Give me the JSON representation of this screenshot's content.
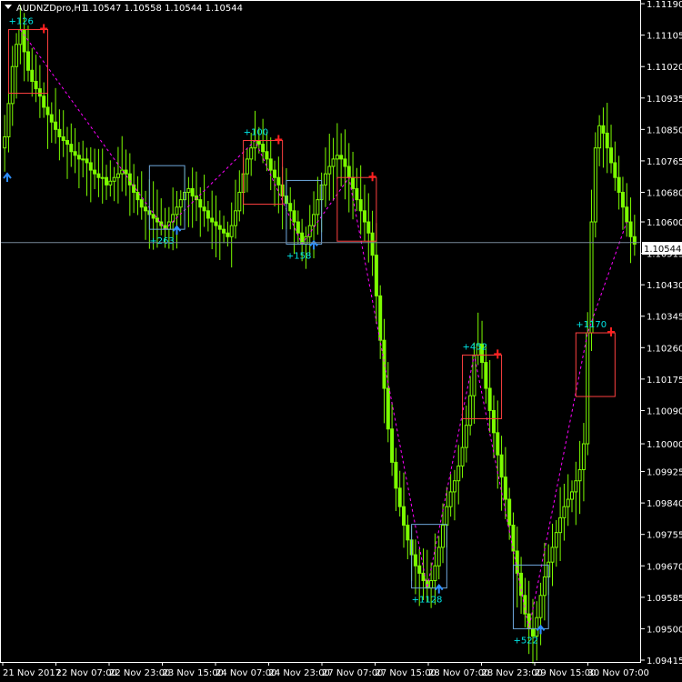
{
  "header": {
    "symbol": "AUDNZDpro,H1",
    "ohlc": "1.10547 1.10558 1.10544 1.10544"
  },
  "colors": {
    "background": "#000000",
    "axis": "#ffffff",
    "candles": "#7cfc00",
    "bid_line": "#778899",
    "zigzag": "#ff00ff",
    "top_box": "#ff4040",
    "bottom_box": "#6fa8dc",
    "top_label": "#00e5e5",
    "bottom_label": "#00e5e5",
    "up_arrow": "#2f8fff",
    "down_arrow": "#ff2020"
  },
  "chart_data": {
    "type": "candlestick",
    "title": "AUDNZDpro,H1",
    "ylim": [
      1.0941,
      1.112
    ],
    "price_ticks": [
      "1.11190",
      "1.11105",
      "1.11020",
      "1.10935",
      "1.10850",
      "1.10765",
      "1.10680",
      "1.10600",
      "1.10515",
      "1.10430",
      "1.10345",
      "1.10260",
      "1.10175",
      "1.10090",
      "1.10000",
      "1.09925",
      "1.09840",
      "1.09755",
      "1.09670",
      "1.09585",
      "1.09500",
      "1.09415"
    ],
    "time_ticks": [
      "21 Nov 2017",
      "22 Nov 07:00",
      "22 Nov 23:00",
      "23 Nov 15:00",
      "24 Nov 07:00",
      "24 Nov 23:00",
      "27 Nov 07:00",
      "27 Nov 15:00",
      "28 Nov 07:00",
      "28 Nov 23:00",
      "29 Nov 15:00",
      "30 Nov 07:00"
    ],
    "current_price": "1.10544",
    "closes": [
      1.1083,
      1.1092,
      1.1102,
      1.1108,
      1.1112,
      1.1106,
      1.1101,
      1.1098,
      1.1096,
      1.1094,
      1.1091,
      1.1089,
      1.1087,
      1.1085,
      1.1083,
      1.1082,
      1.1081,
      1.1079,
      1.1078,
      1.1077,
      1.1077,
      1.1076,
      1.1074,
      1.1073,
      1.1072,
      1.1072,
      1.107,
      1.1071,
      1.1072,
      1.1073,
      1.1074,
      1.1073,
      1.107,
      1.1068,
      1.1066,
      1.1064,
      1.1063,
      1.1062,
      1.1061,
      1.106,
      1.1059,
      1.1058,
      1.106,
      1.1062,
      1.1064,
      1.1066,
      1.1068,
      1.1069,
      1.1067,
      1.1066,
      1.1064,
      1.1063,
      1.1061,
      1.106,
      1.1059,
      1.1058,
      1.1057,
      1.1056,
      1.1059,
      1.1063,
      1.1068,
      1.1073,
      1.1077,
      1.108,
      1.1082,
      1.1081,
      1.1079,
      1.1077,
      1.1074,
      1.1072,
      1.107,
      1.1067,
      1.1065,
      1.1063,
      1.106,
      1.1057,
      1.1054,
      1.1056,
      1.1059,
      1.1062,
      1.1066,
      1.107,
      1.1073,
      1.1075,
      1.1077,
      1.1078,
      1.1077,
      1.1075,
      1.1072,
      1.1069,
      1.1066,
      1.1063,
      1.106,
      1.1057,
      1.1051,
      1.104,
      1.1028,
      1.1015,
      1.1004,
      1.0995,
      1.0988,
      1.0983,
      1.0978,
      1.0974,
      1.097,
      1.0967,
      1.0965,
      1.0963,
      1.0961,
      1.0963,
      1.0967,
      1.0972,
      1.0978,
      1.0983,
      1.0987,
      1.099,
      1.0994,
      1.0999,
      1.1005,
      1.1013,
      1.1024,
      1.1027,
      1.1022,
      1.1015,
      1.1009,
      1.1003,
      1.0997,
      1.0991,
      1.0985,
      1.0978,
      1.0971,
      1.0965,
      1.0959,
      1.0954,
      1.095,
      1.0948,
      1.0953,
      1.0959,
      1.0964,
      1.0968,
      1.0972,
      1.0976,
      1.098,
      1.0983,
      1.0985,
      1.0987,
      1.099,
      1.0993,
      1.1,
      1.103,
      1.106,
      1.108,
      1.1086,
      1.1084,
      1.108,
      1.1076,
      1.1072,
      1.1068,
      1.1064,
      1.106,
      1.1056,
      1.1054
    ],
    "zigzag_labels": [
      {
        "text": "+126",
        "kind": "top"
      },
      {
        "text": "+263",
        "kind": "bottom"
      },
      {
        "text": "+100",
        "kind": "top"
      },
      {
        "text": "+158",
        "kind": "bottom"
      },
      {
        "text": "+452",
        "kind": "top"
      },
      {
        "text": "+1128",
        "kind": "bottom"
      },
      {
        "text": "+522",
        "kind": "bottom"
      },
      {
        "text": "+1170",
        "kind": "top"
      }
    ]
  }
}
